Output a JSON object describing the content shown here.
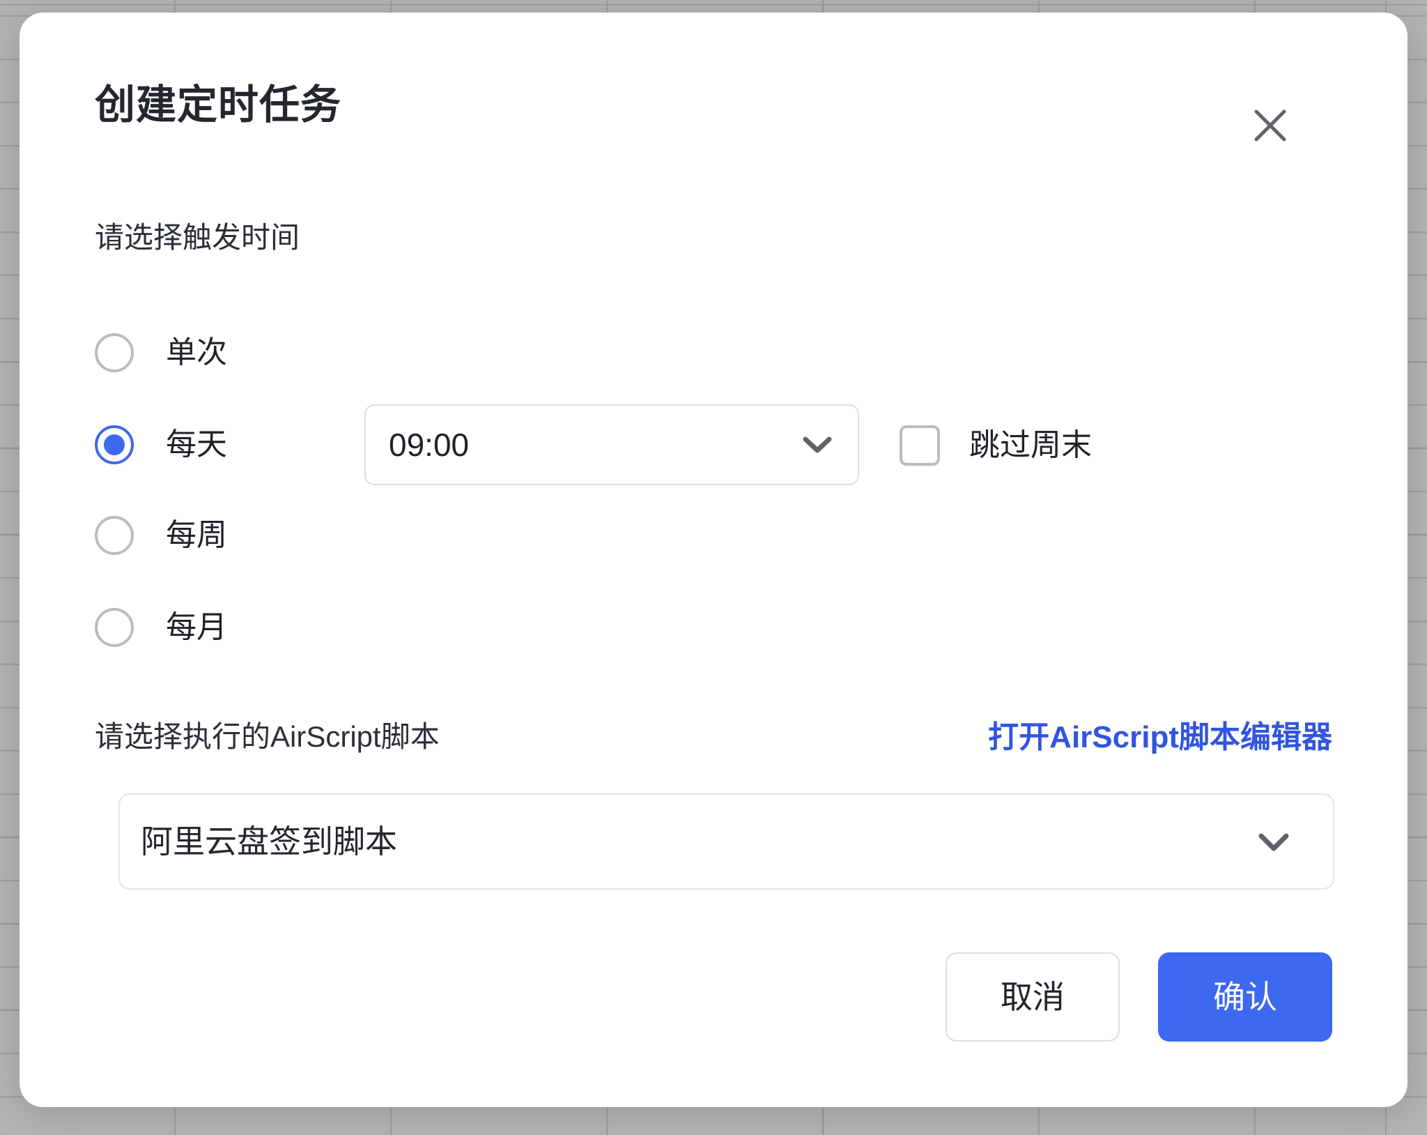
{
  "dialog": {
    "title": "创建定时任务",
    "close_icon": "close-icon"
  },
  "trigger": {
    "label": "请选择触发时间",
    "options": [
      {
        "label": "单次",
        "selected": false
      },
      {
        "label": "每天",
        "selected": true
      },
      {
        "label": "每周",
        "selected": false
      },
      {
        "label": "每月",
        "selected": false
      }
    ],
    "time_select": {
      "value": "09:00",
      "chevron_icon": "chevron-down-icon"
    },
    "skip_weekend": {
      "label": "跳过周末",
      "checked": false
    }
  },
  "script": {
    "label": "请选择执行的AirScript脚本",
    "editor_link": "打开AirScript脚本编辑器",
    "select": {
      "value": "阿里云盘签到脚本",
      "chevron_icon": "chevron-down-icon"
    }
  },
  "footer": {
    "cancel_label": "取消",
    "confirm_label": "确认"
  },
  "colors": {
    "accent": "#3d68f0",
    "link": "#3155e0",
    "text": "#1f2227",
    "border": "#dcdee3",
    "backdrop": "#b3b3b3"
  }
}
